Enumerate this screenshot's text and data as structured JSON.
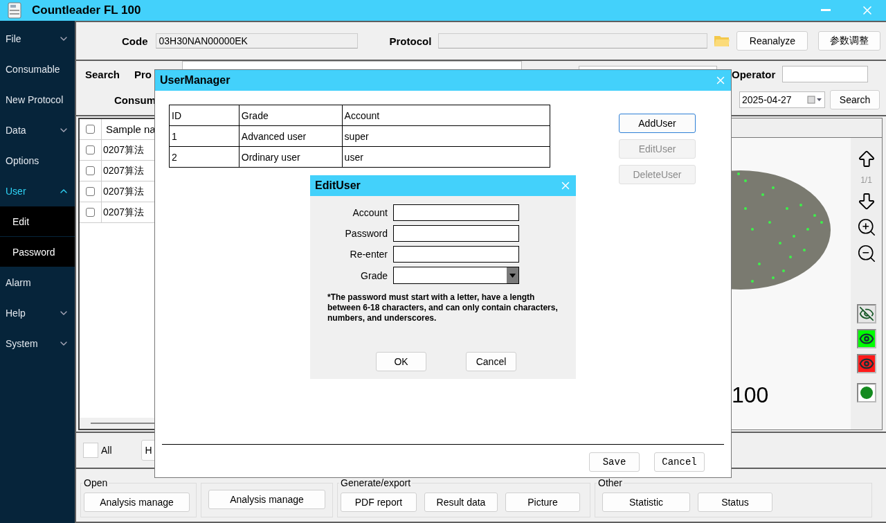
{
  "window": {
    "title": "Countleader FL 100"
  },
  "sidebar": {
    "items": [
      {
        "label": "File",
        "kind": "group",
        "expanded": false,
        "selected": false
      },
      {
        "label": "Consumable",
        "kind": "link",
        "selected": false
      },
      {
        "label": "New Protocol",
        "kind": "link",
        "selected": false
      },
      {
        "label": "Data",
        "kind": "group",
        "expanded": false,
        "selected": false
      },
      {
        "label": "Options",
        "kind": "link",
        "selected": false
      },
      {
        "label": "User",
        "kind": "group",
        "expanded": true,
        "selected": true,
        "children": [
          {
            "label": "Edit"
          },
          {
            "label": "Password"
          }
        ]
      },
      {
        "label": "Alarm",
        "kind": "link",
        "selected": false
      },
      {
        "label": "Help",
        "kind": "group",
        "expanded": false,
        "selected": false
      },
      {
        "label": "System",
        "kind": "group",
        "expanded": false,
        "selected": false
      }
    ]
  },
  "code_bar": {
    "code_label": "Code",
    "code_value": "03H30NAN00000EK",
    "protocol_label": "Protocol",
    "buttons": [
      "Reanalyze",
      "参数调整"
    ]
  },
  "search_panel": {
    "title": "Search",
    "protocol_label": "Pro",
    "operator_label": "Operator",
    "consumable_label": "Consum",
    "date": "2025-04-27",
    "button": "Search"
  },
  "sample_table": {
    "all_checked": false,
    "column_1": "Sample na",
    "rows": [
      {
        "checked": false,
        "name": "0207算法"
      },
      {
        "checked": false,
        "name": "0207算法"
      },
      {
        "checked": false,
        "name": "0207算法"
      },
      {
        "checked": false,
        "name": "0207算法"
      }
    ]
  },
  "bottom_bar": {
    "all_label": "All",
    "all_checked": false,
    "button": "H"
  },
  "image_panel": {
    "page": "1/1",
    "count": "100"
  },
  "action_groups": [
    {
      "title": "Open",
      "buttons": [
        "Analysis manage"
      ]
    },
    {
      "buttons": [
        "Analysis manage"
      ]
    },
    {
      "title": "Generate/export",
      "buttons": [
        "PDF report",
        "Result data",
        "Picture"
      ]
    },
    {
      "title": "Other",
      "buttons": [
        "Statistic",
        "Status"
      ]
    }
  ],
  "user_manager": {
    "title": "UserManager",
    "columns": [
      "ID",
      "Grade",
      "Account"
    ],
    "rows": [
      [
        "1",
        "Advanced user",
        "super"
      ],
      [
        "2",
        "Ordinary user",
        "user"
      ]
    ],
    "side_buttons": [
      {
        "label": "AddUser",
        "disabled": false
      },
      {
        "label": "EditUser",
        "disabled": true
      },
      {
        "label": "DeleteUser",
        "disabled": true
      }
    ],
    "footer_buttons": [
      "Save",
      "Cancel"
    ]
  },
  "edit_user": {
    "title": "EditUser",
    "fields": [
      {
        "label": "Account",
        "kind": "text"
      },
      {
        "label": "Password",
        "kind": "text"
      },
      {
        "label": "Re-enter",
        "kind": "text"
      },
      {
        "label": "Grade",
        "kind": "select"
      }
    ],
    "note": "*The password must start with a letter, have a length between 6-18 characters, and can only contain characters, numbers, and underscores.",
    "buttons": [
      "OK",
      "Cancel"
    ]
  }
}
